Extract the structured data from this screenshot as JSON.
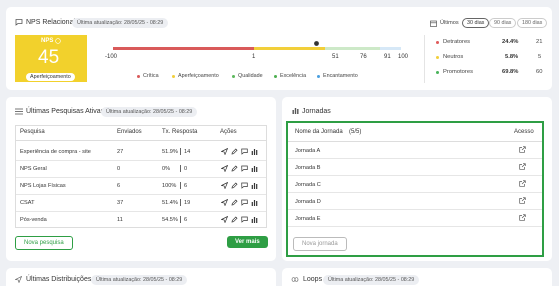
{
  "nps": {
    "title": "NPS Relacional",
    "last_update": "Última atualização: 28/05/25 - 08:29",
    "period_label": "Últimos",
    "periods": [
      "30 dias",
      "90 dias",
      "180 dias"
    ],
    "score_label": "NPS",
    "score": "45",
    "zone": "Aperfeiçoamento",
    "scale_ticks": [
      "-100",
      "1",
      "51",
      "76",
      "91",
      "100"
    ],
    "marker_value": 45,
    "legend": [
      "Crítica",
      "Aperfeiçoamento",
      "Qualidade",
      "Excelência",
      "Encantamento"
    ],
    "breakdown": [
      {
        "label": "Detratores",
        "percent": "24.4%",
        "count": "21",
        "color": "#e05a5a"
      },
      {
        "label": "Neutros",
        "percent": "5.8%",
        "count": "5",
        "color": "#f2cf3a"
      },
      {
        "label": "Promotores",
        "percent": "69.8%",
        "count": "60",
        "color": "#48b35a"
      }
    ],
    "colors": {
      "critica": "#d95a5a",
      "aperfeicoamento": "#f2cf3a",
      "qualidade": "#5cb85c",
      "excelencia": "#4caf50",
      "encantamento": "#4a9fe0",
      "score_bg": "#f2d12c"
    }
  },
  "surveys": {
    "title": "Últimas Pesquisas Ativas",
    "last_update": "Última atualização: 28/05/25 - 08:29",
    "columns": [
      "Pesquisa",
      "Enviados",
      "Tx. Resposta",
      "Ações"
    ],
    "rows": [
      {
        "name": "Experiência de compra - site",
        "sent": "27",
        "rate": "51.9%",
        "responses": "14"
      },
      {
        "name": "NPS Geral",
        "sent": "0",
        "rate": "0%",
        "responses": "0"
      },
      {
        "name": "NPS Lojas Físicas",
        "sent": "6",
        "rate": "100%",
        "responses": "6"
      },
      {
        "name": "CSAT",
        "sent": "37",
        "rate": "51.4%",
        "responses": "19"
      },
      {
        "name": "Pós-venda",
        "sent": "11",
        "rate": "54.5%",
        "responses": "6"
      }
    ],
    "new_button": "Nova pesquisa",
    "more_button": "Ver mais"
  },
  "journeys": {
    "title": "Jornadas",
    "column_name": "Nome da Jornada",
    "count": "(5/5)",
    "column_access": "Acesso",
    "items": [
      "Jornada A",
      "Jornada B",
      "Jornada C",
      "Jornada D",
      "Jornada E"
    ],
    "new_button": "Nova jornada"
  },
  "distributions": {
    "title": "Últimas Distribuições",
    "last_update": "Última atualização: 28/05/25 - 08:29"
  },
  "loops": {
    "title": "Loops",
    "last_update": "Última atualização: 28/05/25 - 08:29"
  }
}
